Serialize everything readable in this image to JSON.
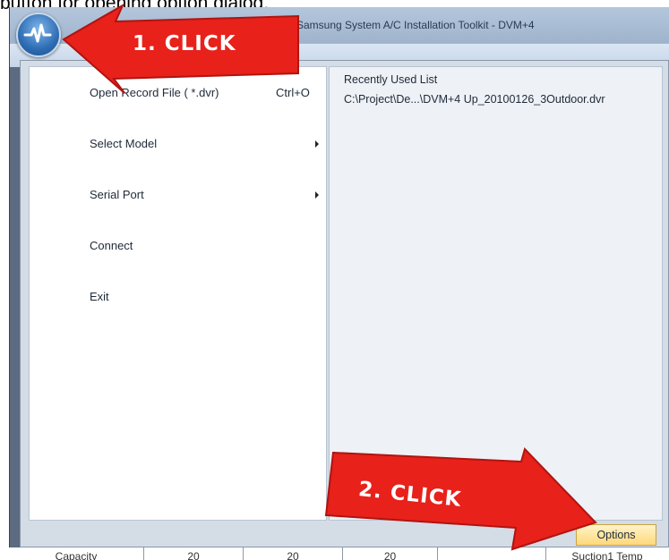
{
  "caption": "button for opening option dialog.",
  "window": {
    "title": "Samsung System A/C Installation Toolkit - DVM+4"
  },
  "app_menu": {
    "items": [
      {
        "label": "Open Record File ( *.dvr)",
        "shortcut": "Ctrl+O",
        "submenu": false
      },
      {
        "label": "Select Model",
        "shortcut": "",
        "submenu": true
      },
      {
        "label": "Serial Port",
        "shortcut": "",
        "submenu": true
      },
      {
        "label": "Connect",
        "shortcut": "",
        "submenu": false
      },
      {
        "label": "Exit",
        "shortcut": "",
        "submenu": false
      }
    ],
    "recent": {
      "title": "Recently Used List",
      "items": [
        "C:\\Project\\De...\\DVM+4 Up_20100126_3Outdoor.dvr"
      ]
    },
    "options_label": "Options"
  },
  "annotations": {
    "callout1": "1. CLICK",
    "callout2": "2. CLICK",
    "arrow_color": "#e8211b"
  },
  "bottom_row": [
    "Capacity",
    "20",
    "20",
    "20",
    "",
    "Suction1 Temp"
  ]
}
